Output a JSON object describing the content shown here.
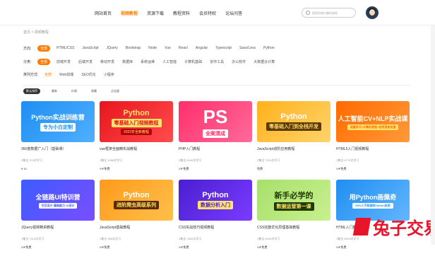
{
  "nav": {
    "items": [
      "网站首页",
      "视频教程",
      "资源下载",
      "教程资料",
      "会员特权",
      "论坛问答"
    ],
    "active_index": 1,
    "search_placeholder": "搜索你感兴趣的课程"
  },
  "breadcrumb": "首页 > 视频教程",
  "filters": [
    {
      "label": "方向:",
      "options": [
        "全部",
        "HTML/CSS",
        "JavaScript",
        "JQuery",
        "Bootstrap",
        "Node",
        "Vue",
        "React",
        "Angular",
        "Typescript",
        "Sass/Less",
        "Python"
      ],
      "selected": 0
    },
    {
      "label": "分类:",
      "options": [
        "全部",
        "前端开发",
        "后端开发",
        "移动开发",
        "数据库",
        "系统运维",
        "人工智能",
        "计算机基础",
        "协作工具",
        "办公软件",
        "大数据云计算"
      ],
      "selected": 0
    },
    {
      "label": "排列方式:",
      "options": [
        "全部",
        "Web前端",
        "SEO优化",
        "小程序"
      ],
      "selected": 0
    }
  ],
  "sort": {
    "options": [
      "默认排序",
      "最新",
      "价格",
      "收藏",
      "点击量"
    ],
    "selected": 0
  },
  "cards": [
    {
      "line1": "Python实战训练营",
      "line2": "专为小白定制",
      "bg": "#1f8ef1",
      "bg2": "#4fb0ff",
      "fg": "#ffffff",
      "badge_bg": "#ffffff",
      "badge_fg": "#1f8ef1",
      "title": "360度数据广入门（基础课）",
      "meta": "2集全 970次学习",
      "price": "¥ 10"
    },
    {
      "line1": "Python",
      "line2": "零基础入门视频教程",
      "line3": "2022年全新教程",
      "bg": "#e8141e",
      "bg2": "#ff4d4d",
      "fg": "#ffe36b",
      "badge_bg": "#ffe36b",
      "badge_fg": "#e8141e",
      "title": "vue框架全面精实战教程",
      "meta": "1集全 1058次学习",
      "price": "VIP免费"
    },
    {
      "line1": "PS",
      "line2": "全案漂成",
      "bg": "#ff2f6b",
      "bg2": "#ff6a9a",
      "fg": "#ffffff",
      "badge_bg": "#ffffff",
      "badge_fg": "#ff2f6b",
      "title": "PHP入门教程",
      "meta": "2集全 6160次学习",
      "price": "VIP免费"
    },
    {
      "line1": "Python",
      "line2": "零基础入门到全栈开发",
      "bg": "#ffb11b",
      "bg2": "#ffd36b",
      "fg": "#ffffff",
      "badge_bg": "#5a3a00",
      "badge_fg": "#ffd36b",
      "title": "JavaScript进阶应用教程",
      "meta": "2集全 7210次学习",
      "price": "免费"
    },
    {
      "line1": "人工智能CV+NLP实战课",
      "line2": "深度学习+计算机视觉+自然语言处理",
      "bg": "#ff6a00",
      "bg2": "#ff9a3a",
      "fg": "#ffffff",
      "badge_bg": "#ffe36b",
      "badge_fg": "#ff6a00",
      "title": "HTML5入门视频教程",
      "meta": "1集全 6770次学习",
      "price": "VIP免费"
    },
    {
      "line1": "全链路UI特训营",
      "line2": "交互设计·基础能力·UI设计",
      "bg": "#3d5cff",
      "bg2": "#7a4dff",
      "fg": "#ffffff",
      "badge_bg": "#ffffff",
      "badge_fg": "#3d5cff",
      "title": "JQuery视频精讲教程",
      "meta": "1集全 7310次学习",
      "price": "VIP免费"
    },
    {
      "line1": "Python",
      "line2": "进阶爬虫高级系列",
      "bg": "#ff9a1b",
      "bg2": "#ffc04a",
      "fg": "#ffffff",
      "badge_bg": "#5a2a00",
      "badge_fg": "#ffe36b",
      "title": "JavaScript基础教程",
      "meta": "1集全 985次学习",
      "price": "VIP免费"
    },
    {
      "line1": "Python",
      "line2": "数据分析入门",
      "bg": "#4a1fd1",
      "bg2": "#7a3bff",
      "fg": "#ffffff",
      "badge_bg": "#ffe36b",
      "badge_fg": "#4a1fd1",
      "title": "CSS实战技巧视频教程",
      "meta": "2集全 7660次学习",
      "price": "VIP免费"
    },
    {
      "line1": "新手必学的",
      "line2": "数据运营第一课",
      "bg": "#a7e06b",
      "bg2": "#c8f08f",
      "fg": "#1f3a00",
      "badge_bg": "#1f3a00",
      "badge_fg": "#ffe36b",
      "title": "CSS完整优化原理基础教程",
      "meta": "2集全 8430次学习",
      "price": "VIP免费"
    },
    {
      "line1": "用Python画佩奇",
      "line2": "99%人不知道的Python应用",
      "bg": "#1f8ef1",
      "bg2": "#63b6ff",
      "fg": "#ffffff",
      "badge_bg": "#ffffff",
      "badge_fg": "#1f8ef1",
      "title": "HTML入门教程",
      "meta": "1集全 5510次学习",
      "price": "VIP免费"
    }
  ],
  "watermark": {
    "text": "兔子交易",
    "color": "#e8142a"
  }
}
